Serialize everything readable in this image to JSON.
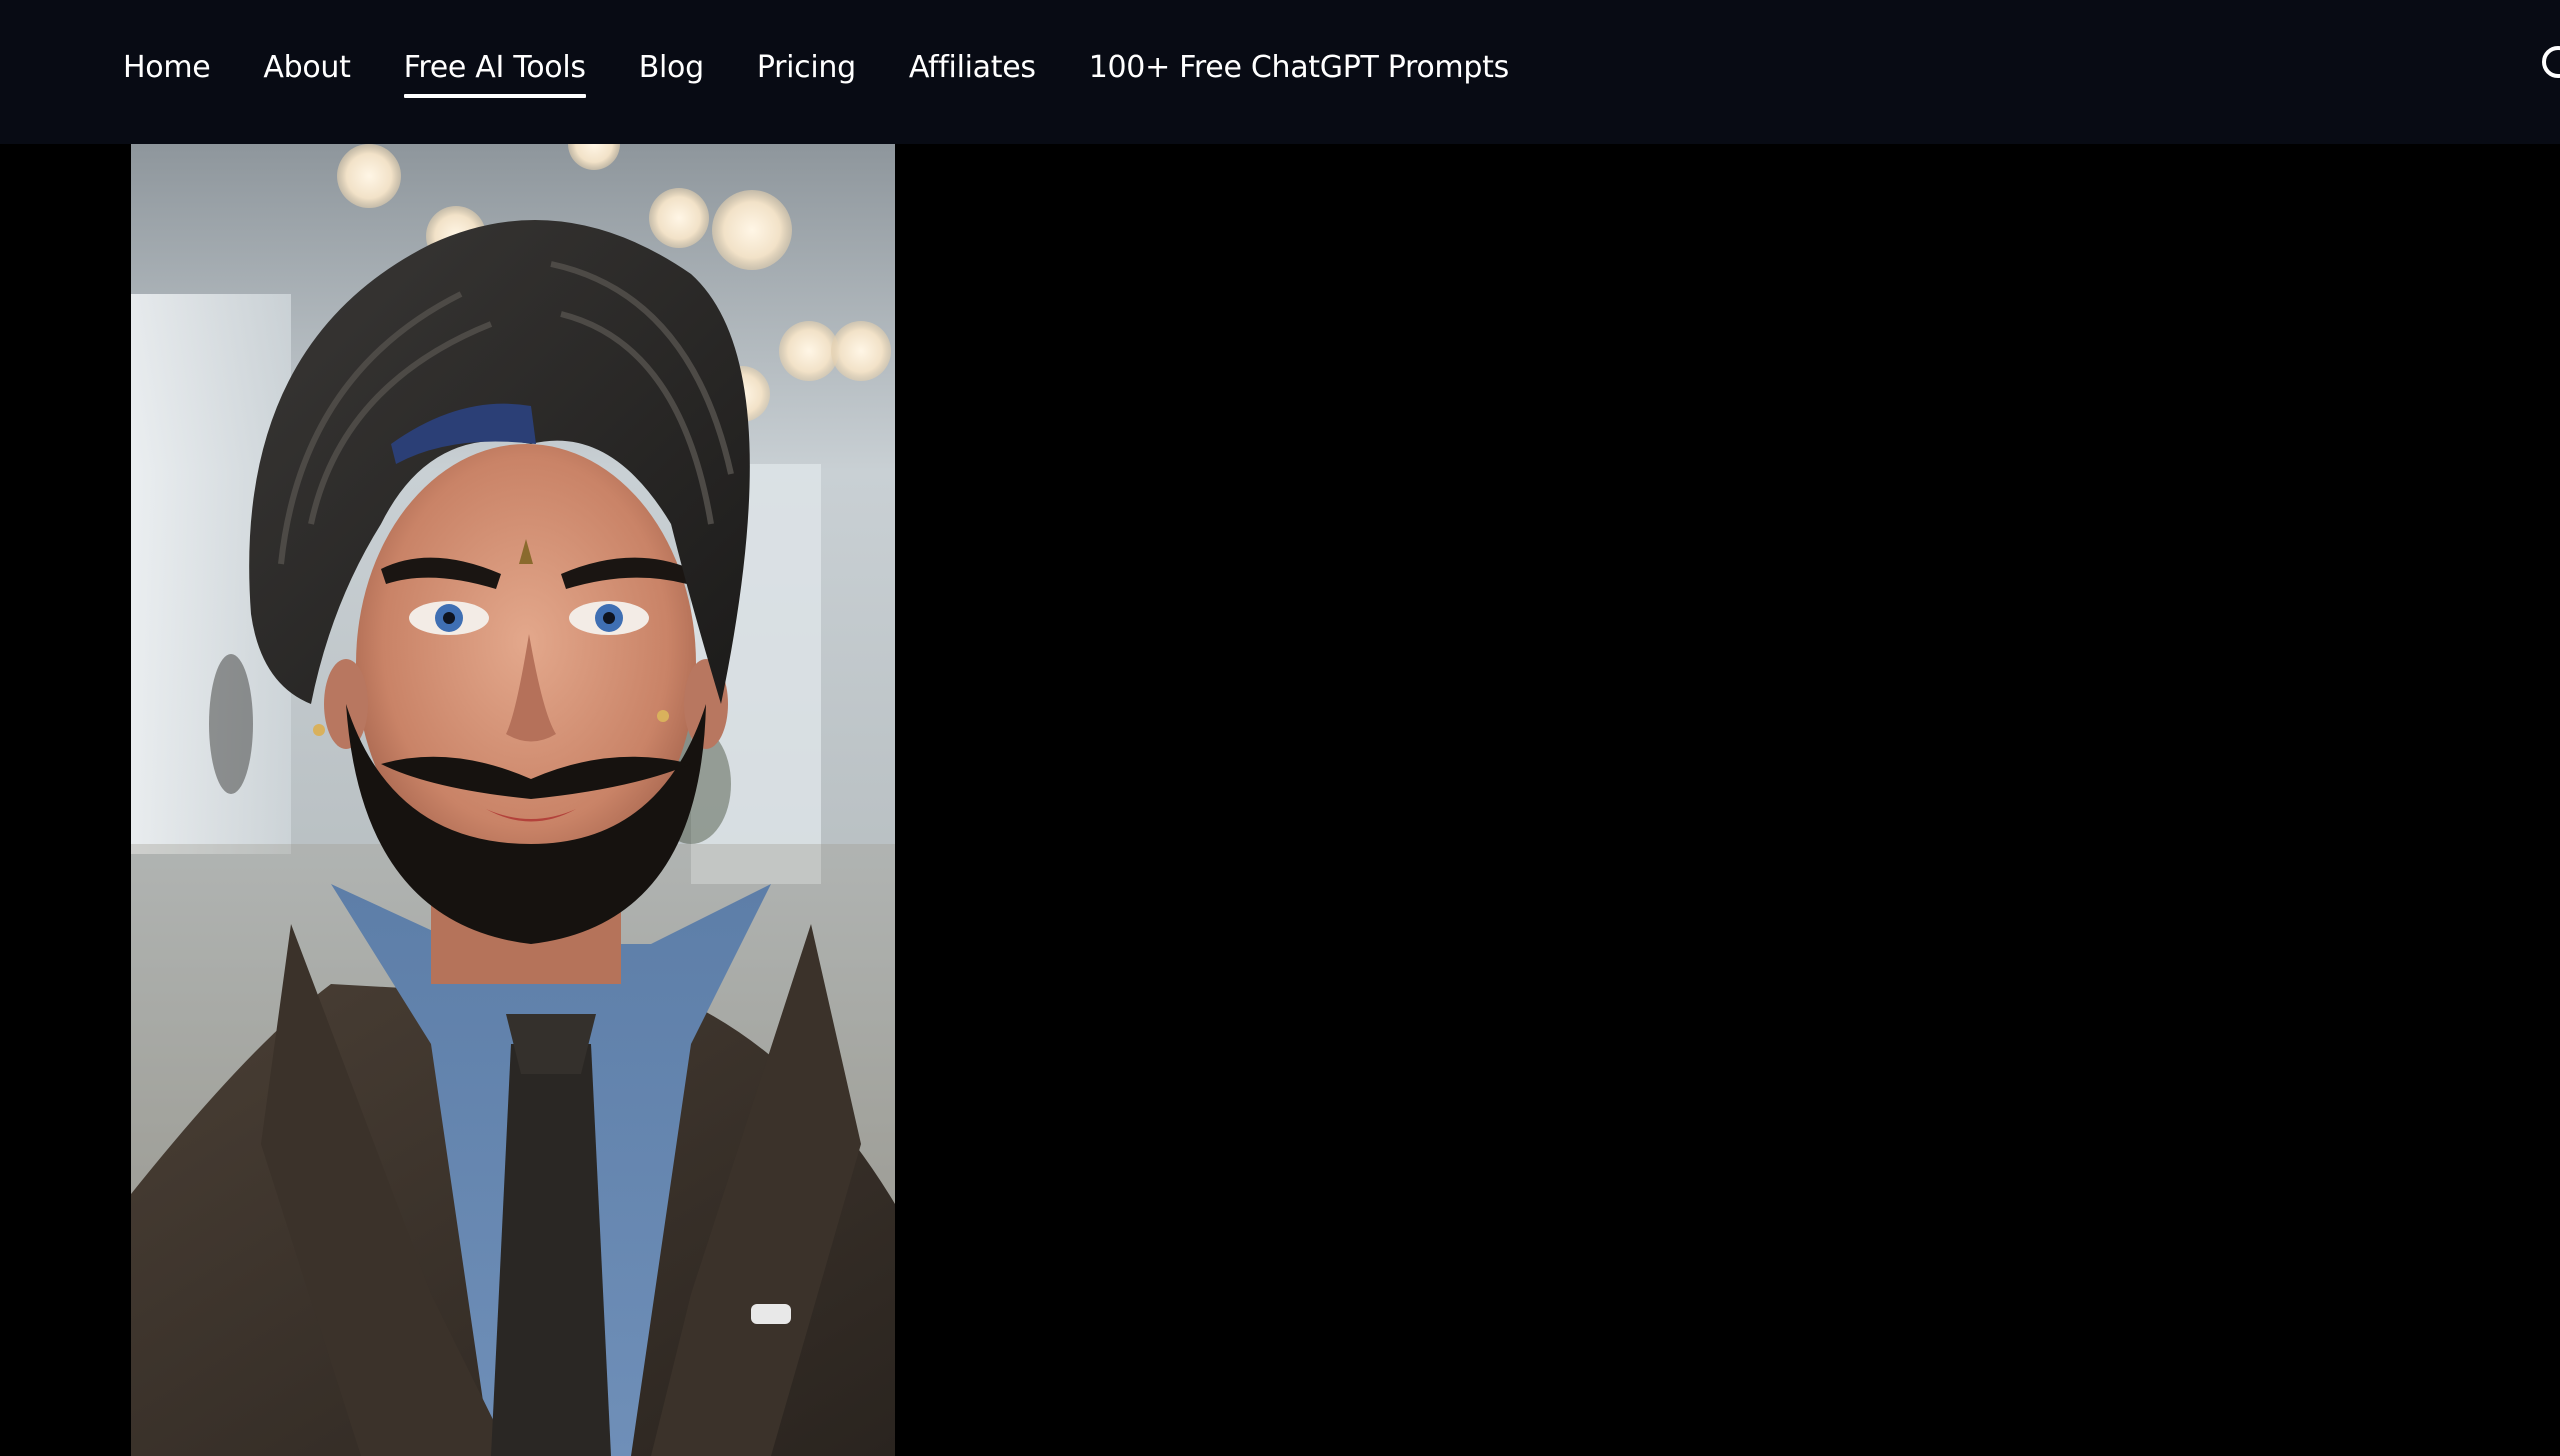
{
  "nav": {
    "items": [
      {
        "label": "Home",
        "active": false
      },
      {
        "label": "About",
        "active": false
      },
      {
        "label": "Free AI Tools",
        "active": true
      },
      {
        "label": "Blog",
        "active": false
      },
      {
        "label": "Pricing",
        "active": false
      },
      {
        "label": "Affiliates",
        "active": false
      },
      {
        "label": "100+ Free ChatGPT Prompts",
        "active": false
      }
    ],
    "search_icon": "search-icon"
  },
  "colors": {
    "nav_background": "#080b14",
    "page_background": "#000000",
    "nav_text": "#ffffff"
  }
}
